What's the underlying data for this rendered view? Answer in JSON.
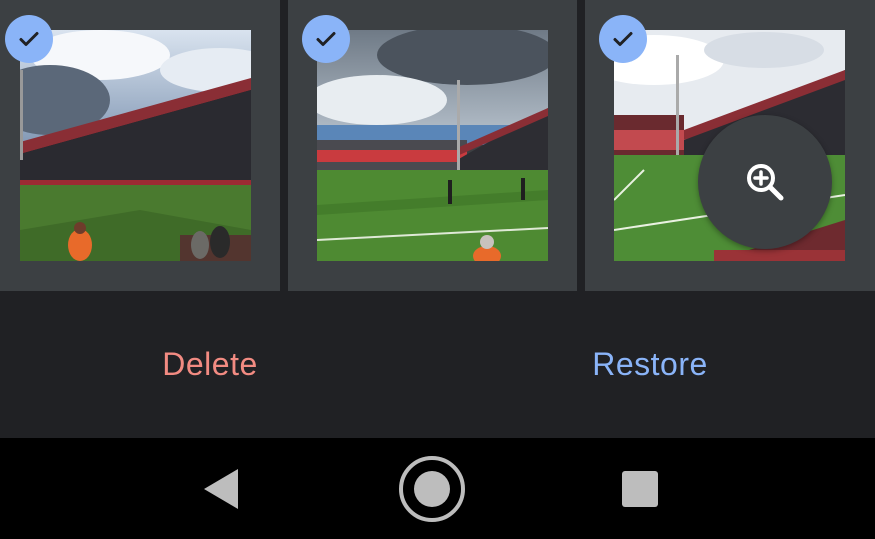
{
  "photos": [
    {
      "selected": true,
      "icon": "check-icon"
    },
    {
      "selected": true,
      "icon": "check-icon"
    },
    {
      "selected": true,
      "icon": "check-icon"
    }
  ],
  "zoom": {
    "icon": "zoom-in-icon"
  },
  "actions": {
    "delete_label": "Delete",
    "restore_label": "Restore"
  },
  "colors": {
    "background": "#202124",
    "tile": "#3c4043",
    "check": "#8ab4f8",
    "delete": "#f28b82",
    "restore": "#8ab4f8",
    "nav_bar": "#000000"
  },
  "navbar": {
    "back_icon": "back-triangle-icon",
    "home_icon": "home-circle-icon",
    "recents_icon": "recents-square-icon"
  }
}
